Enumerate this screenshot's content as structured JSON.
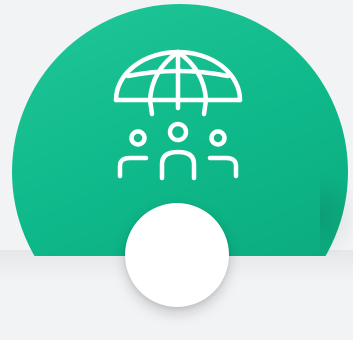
{
  "colors": {
    "accent": "#10bb8c",
    "background": "#f2f3f5",
    "icon_stroke": "#ffffff",
    "button_fill": "#ffffff"
  },
  "icons": {
    "main": "globe-community-icon"
  }
}
